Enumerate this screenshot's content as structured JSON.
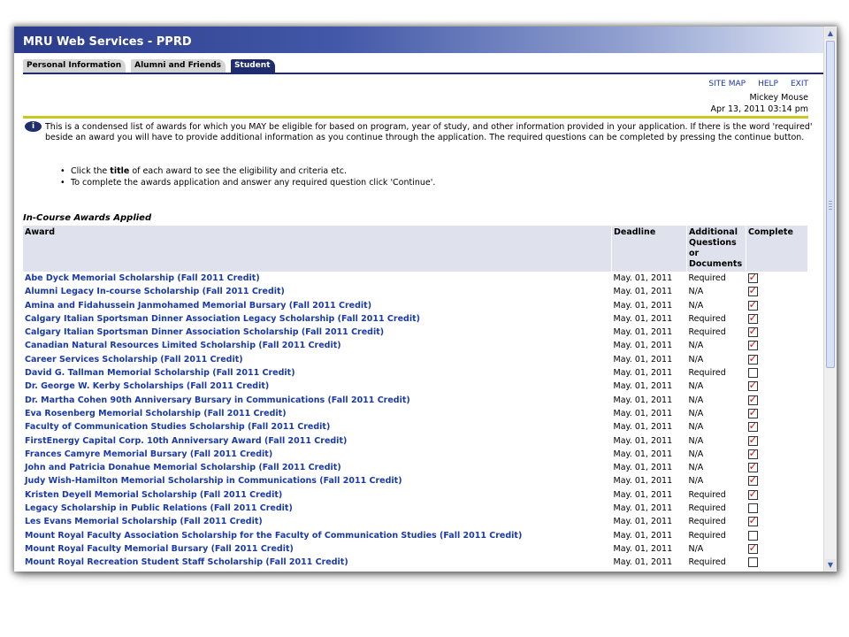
{
  "window": {
    "title": "MRU Web Services - PPRD"
  },
  "tabs": [
    {
      "label": "Personal Information",
      "active": false
    },
    {
      "label": "Alumni and Friends",
      "active": false
    },
    {
      "label": "Student",
      "active": true
    }
  ],
  "top_links": {
    "site_map": "SITE MAP",
    "help": "HELP",
    "exit": "EXIT"
  },
  "user": {
    "name": "Mickey Mouse",
    "datetime": "Apr 13, 2011 03:14 pm"
  },
  "info": {
    "text": "This is a condensed list of awards for which you MAY be eligible for based on program, year of study, and other information provided in your application. If there is the word 'required' beside an award you will have to provide additional information as you continue through the application. The required questions can be completed by pressing the continue button.",
    "bullet1_pre": "Click the ",
    "bullet1_bold": "title",
    "bullet1_post": " of each award to see the eligibility and criteria etc.",
    "bullet2": "To complete the awards application and answer any required question click 'Continue'."
  },
  "section_title": "In-Course Awards Applied",
  "table": {
    "headers": {
      "award": "Award",
      "deadline": "Deadline",
      "questions_line1": "Additional",
      "questions_line2": "Questions",
      "questions_line3": "or",
      "questions_line4": "Documents",
      "complete": "Complete"
    },
    "rows": [
      {
        "name": "Abe Dyck Memorial Scholarship (Fall 2011 Credit)",
        "deadline": "May. 01, 2011",
        "questions": "Required",
        "complete": true
      },
      {
        "name": "Alumni Legacy In-course Scholarship (Fall 2011 Credit)",
        "deadline": "May. 01, 2011",
        "questions": "N/A",
        "complete": true
      },
      {
        "name": "Amina and Fidahussein Janmohamed Memorial Bursary (Fall 2011 Credit)",
        "deadline": "May. 01, 2011",
        "questions": "N/A",
        "complete": true
      },
      {
        "name": "Calgary Italian Sportsman Dinner Association Legacy Scholarship (Fall 2011 Credit)",
        "deadline": "May. 01, 2011",
        "questions": "Required",
        "complete": true
      },
      {
        "name": "Calgary Italian Sportsman Dinner Association Scholarship (Fall 2011 Credit)",
        "deadline": "May. 01, 2011",
        "questions": "Required",
        "complete": true
      },
      {
        "name": "Canadian Natural Resources Limited Scholarship (Fall 2011 Credit)",
        "deadline": "May. 01, 2011",
        "questions": "N/A",
        "complete": true
      },
      {
        "name": "Career Services Scholarship (Fall 2011 Credit)",
        "deadline": "May. 01, 2011",
        "questions": "N/A",
        "complete": true
      },
      {
        "name": "David G. Tallman Memorial Scholarship (Fall 2011 Credit)",
        "deadline": "May. 01, 2011",
        "questions": "Required",
        "complete": false
      },
      {
        "name": "Dr. George W. Kerby Scholarships (Fall 2011 Credit)",
        "deadline": "May. 01, 2011",
        "questions": "N/A",
        "complete": true
      },
      {
        "name": "Dr. Martha Cohen 90th Anniversary Bursary in Communications (Fall 2011 Credit)",
        "deadline": "May. 01, 2011",
        "questions": "N/A",
        "complete": true
      },
      {
        "name": "Eva Rosenberg Memorial Scholarship (Fall 2011 Credit)",
        "deadline": "May. 01, 2011",
        "questions": "N/A",
        "complete": true
      },
      {
        "name": "Faculty of Communication Studies Scholarship (Fall 2011 Credit)",
        "deadline": "May. 01, 2011",
        "questions": "N/A",
        "complete": true
      },
      {
        "name": "FirstEnergy Capital Corp. 10th Anniversary Award (Fall 2011 Credit)",
        "deadline": "May. 01, 2011",
        "questions": "N/A",
        "complete": true
      },
      {
        "name": "Frances Camyre Memorial Bursary (Fall 2011 Credit)",
        "deadline": "May. 01, 2011",
        "questions": "N/A",
        "complete": true
      },
      {
        "name": "John and Patricia Donahue Memorial Scholarship (Fall 2011 Credit)",
        "deadline": "May. 01, 2011",
        "questions": "N/A",
        "complete": true
      },
      {
        "name": "Judy Wish-Hamilton Memorial Scholarship in Communications (Fall 2011 Credit)",
        "deadline": "May. 01, 2011",
        "questions": "N/A",
        "complete": true
      },
      {
        "name": "Kristen Deyell Memorial Scholarship (Fall 2011 Credit)",
        "deadline": "May. 01, 2011",
        "questions": "Required",
        "complete": true
      },
      {
        "name": "Legacy Scholarship in Public Relations (Fall 2011 Credit)",
        "deadline": "May. 01, 2011",
        "questions": "Required",
        "complete": false
      },
      {
        "name": "Les Evans Memorial Scholarship (Fall 2011 Credit)",
        "deadline": "May. 01, 2011",
        "questions": "Required",
        "complete": true
      },
      {
        "name": "Mount Royal Faculty Association Scholarship for the Faculty of Communication Studies (Fall 2011 Credit)",
        "deadline": "May. 01, 2011",
        "questions": "Required",
        "complete": false
      },
      {
        "name": "Mount Royal Faculty Memorial Bursary (Fall 2011 Credit)",
        "deadline": "May. 01, 2011",
        "questions": "N/A",
        "complete": true
      },
      {
        "name": "Mount Royal Recreation Student Staff Scholarship (Fall 2011 Credit)",
        "deadline": "May. 01, 2011",
        "questions": "Required",
        "complete": false
      }
    ]
  },
  "icons": {
    "info": "info-icon",
    "scroll_up": "scroll-up-arrow-icon",
    "scroll_down": "scroll-down-arrow-icon"
  },
  "colors": {
    "link": "#1a3aa8",
    "header_bg": "#1f2d6e",
    "check": "#d01818",
    "highlight_bar": "#c8c820"
  }
}
